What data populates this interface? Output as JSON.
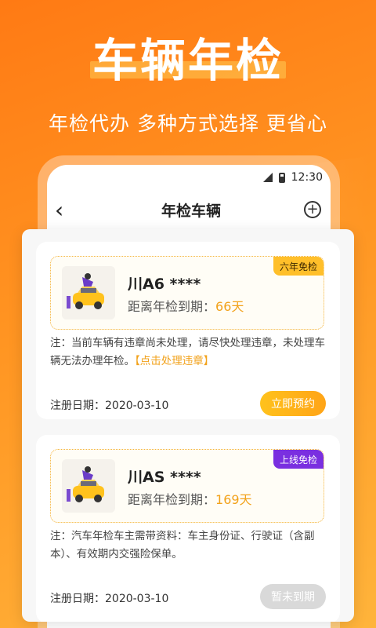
{
  "hero": {
    "title": "车辆年检",
    "subtitle": "年检代办  多种方式选择  更省心"
  },
  "status_bar": {
    "time": "12:30"
  },
  "nav": {
    "back_icon": "chevron-left-icon",
    "title": "年检车辆",
    "add_icon": "plus-circle-icon"
  },
  "colors": {
    "accent": "#ffa417",
    "orange_bg": "#ff8a1c",
    "purple_badge": "#7a2fe0"
  },
  "vehicles": [
    {
      "badge": "六年免检",
      "plate": "川A6 ****",
      "due_label": "距离年检到期：",
      "due_days": "66天",
      "note_text": "注：当前车辆有违章尚未处理，请尽快处理违章，未处理车辆无法办理年检。",
      "note_link": "【点击处理违章】",
      "reg_label": "注册日期：",
      "reg_date": "2020-03-10",
      "action": "立即预约"
    },
    {
      "badge": "上线免检",
      "plate": "川AS ****",
      "due_label": "距离年检到期：",
      "due_days": "169天",
      "note_text": "注：汽车年检车主需带资料：车主身份证、行驶证（含副本）、有效期内交强险保单。",
      "note_link": "",
      "reg_label": "注册日期：",
      "reg_date": "2020-03-10",
      "action": "暂未到期"
    }
  ],
  "peek": {
    "due_label": "距离年检到期：",
    "due_days": "169天"
  }
}
